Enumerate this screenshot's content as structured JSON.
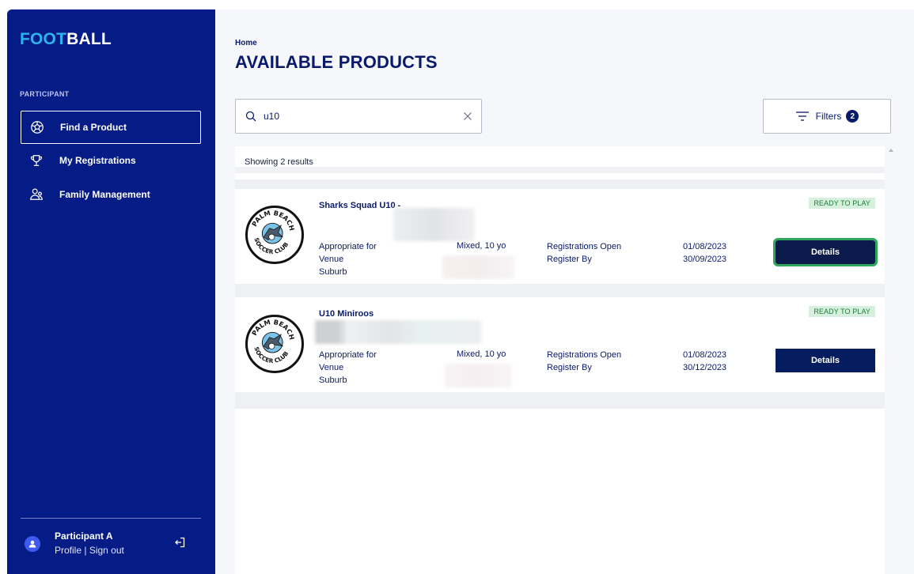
{
  "sidebar": {
    "logo_accent": "FOOT",
    "logo_rest": "BALL",
    "section_label": "PARTICIPANT",
    "items": [
      {
        "label": "Find a Product",
        "icon": "soccer-ball-icon",
        "active": true
      },
      {
        "label": "My Registrations",
        "icon": "trophy-icon",
        "active": false
      },
      {
        "label": "Family Management",
        "icon": "family-icon",
        "active": false
      }
    ],
    "user": {
      "name": "Participant A",
      "profile_label": "Profile",
      "separator": " | ",
      "signout_label": "Sign out"
    }
  },
  "main": {
    "breadcrumb": "Home",
    "title": "AVAILABLE PRODUCTS",
    "search": {
      "value": "u10",
      "placeholder": ""
    },
    "filters": {
      "label": "Filters",
      "count": "2"
    },
    "results_count": "Showing 2 results",
    "products": [
      {
        "title": "Sharks Squad U10 -",
        "status": "READY TO PLAY",
        "labels": [
          "Appropriate for",
          "Venue",
          "Suburb"
        ],
        "appropriate_value": "Mixed, 10 yo",
        "reg_labels": [
          "Registrations Open",
          "Register By"
        ],
        "reg_dates": [
          "01/08/2023",
          "30/09/2023"
        ],
        "button": "Details",
        "logo_text": "PALM BEACH SOCCER CLUB"
      },
      {
        "title": "U10 Miniroos",
        "status": "READY TO PLAY",
        "labels": [
          "Appropriate for",
          "Venue",
          "Suburb"
        ],
        "appropriate_value": "Mixed, 10 yo",
        "reg_labels": [
          "Registrations Open",
          "Register By"
        ],
        "reg_dates": [
          "01/08/2023",
          "30/12/2023"
        ],
        "button": "Details",
        "logo_text": "PALM BEACH SOCCER CLUB"
      }
    ]
  },
  "colors": {
    "sidebar_bg": "#051c86",
    "logo_accent": "#2db4f0",
    "primary_text": "#0a1a6b",
    "button_bg": "#051c5e",
    "focus_ring": "#2fa65a",
    "status_bg": "#d7f0de",
    "status_text": "#1d7a3e"
  }
}
